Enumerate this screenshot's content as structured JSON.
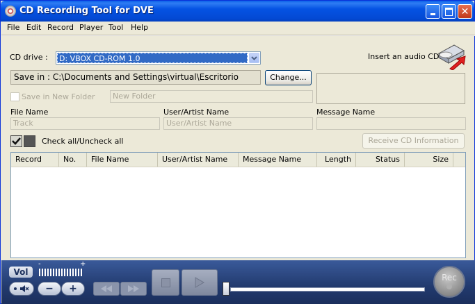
{
  "window": {
    "title": "CD Recording Tool for DVE"
  },
  "menu": [
    "File",
    "Edit",
    "Record",
    "Player",
    "Tool",
    "Help"
  ],
  "cd_drive": {
    "label": "CD drive :",
    "value": "D: VBOX CD-ROM 1.0"
  },
  "insert_hint": "Insert an audio CD.",
  "save": {
    "text": "Save in : C:\\Documents and Settings\\virtual\\Escritorio",
    "change_button": "Change..."
  },
  "new_folder": {
    "checkbox_label": "Save in New Folder",
    "placeholder": "New Folder"
  },
  "fields": {
    "file_name_label": "File Name",
    "file_name_value": "Track",
    "artist_label": "User/Artist Name",
    "artist_value": "User/Artist Name",
    "message_label": "Message Name",
    "message_value": ""
  },
  "check_all_label": "Check all/Uncheck all",
  "receive_button": "Receive CD Information",
  "table": {
    "columns": [
      "Record",
      "No.",
      "File Name",
      "User/Artist Name",
      "Message Name",
      "Length",
      "Status",
      "Size"
    ]
  },
  "player": {
    "vol_label": "Vol",
    "minus": "−",
    "plus": "+",
    "rec_label": "Rec"
  },
  "colors": {
    "title_blue": "#0553e3",
    "player_bg": "#223a6e",
    "arrow_red": "#e02020"
  }
}
